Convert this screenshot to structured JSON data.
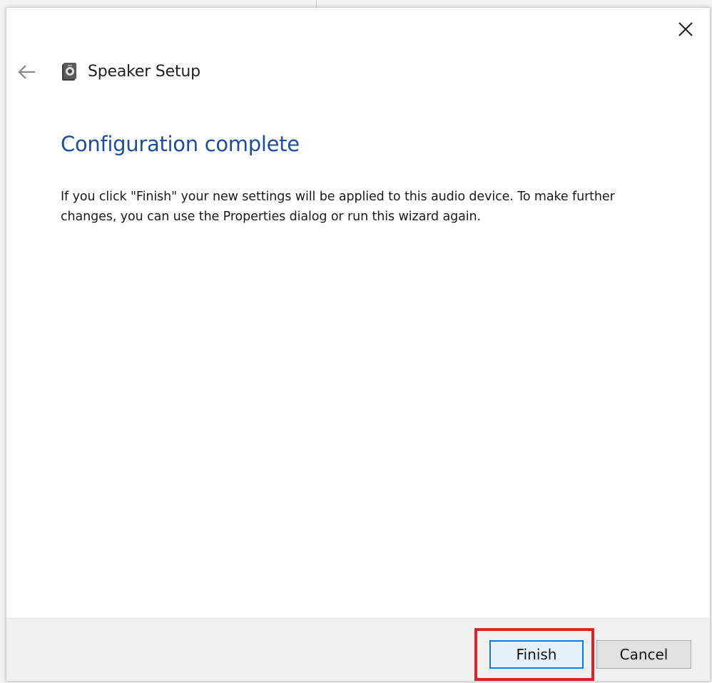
{
  "window": {
    "title": "Speaker Setup",
    "close_icon": "close-icon",
    "back_icon": "back-arrow-icon",
    "app_icon": "speaker-icon"
  },
  "page": {
    "heading": "Configuration complete",
    "body": "If you click \"Finish\" your new settings will be applied to this audio device.  To make further changes, you can use the Properties dialog or run this wizard again."
  },
  "footer": {
    "finish_label": "Finish",
    "cancel_label": "Cancel"
  },
  "colors": {
    "heading": "#1e4e9c",
    "highlight": "#d8232a",
    "default_button_border": "#0a7ad6"
  }
}
